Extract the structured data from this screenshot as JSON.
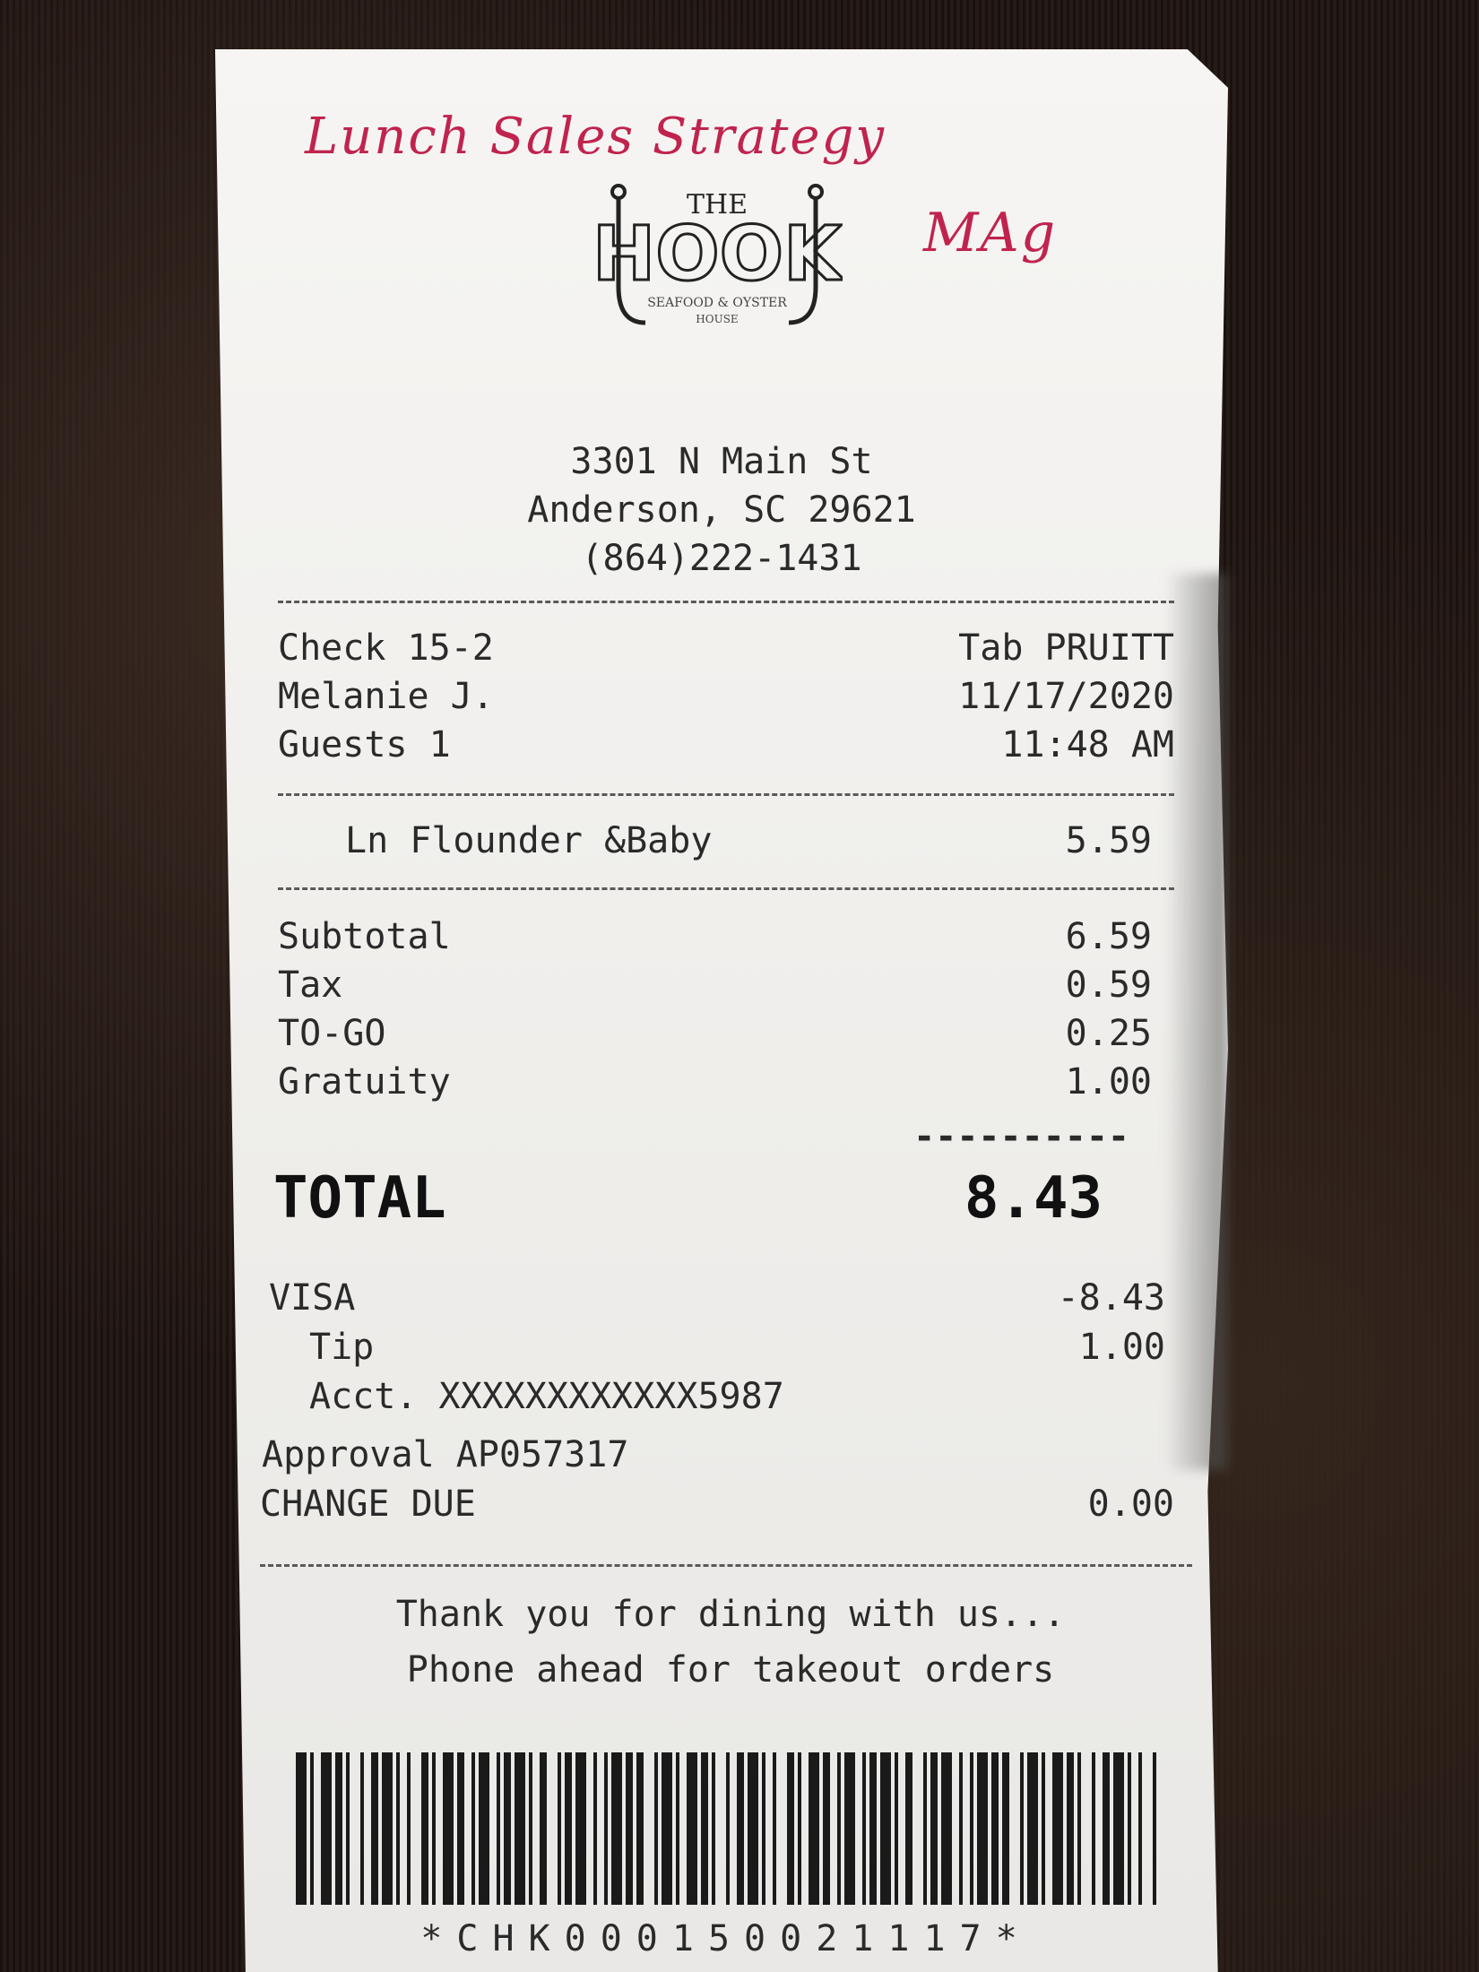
{
  "handwriting": {
    "line1": "Lunch Sales Strategy",
    "line2": "MAg"
  },
  "logo": {
    "top": "THE",
    "main": "HOOK",
    "sub1": "SEAFOOD & OYSTER",
    "sub2": "HOUSE"
  },
  "address": {
    "street": "3301 N Main St",
    "city": "Anderson, SC 29621",
    "phone": "(864)222-1431"
  },
  "check": {
    "number": "Check 15-2",
    "tab": "Tab PRUITT",
    "server": "Melanie J.",
    "date": "11/17/2020",
    "guests": "Guests 1",
    "time": "11:48 AM"
  },
  "items": [
    {
      "name": "Ln Flounder &Baby",
      "price": "5.59"
    }
  ],
  "totals": {
    "subtotal_label": "Subtotal",
    "subtotal": "6.59",
    "tax_label": "Tax",
    "tax": "0.59",
    "togo_label": "TO-GO",
    "togo": "0.25",
    "gratuity_label": "Gratuity",
    "gratuity": "1.00",
    "separator": "----------",
    "total_label": "TOTAL",
    "total": "8.43"
  },
  "payment": {
    "visa_label": "VISA",
    "visa": "-8.43",
    "tip_label": "Tip",
    "tip": "1.00",
    "acct": "Acct. XXXXXXXXXXXX5987",
    "approval": "Approval AP057317",
    "change_label": "CHANGE DUE",
    "change": "0.00"
  },
  "footer": {
    "line1": "Thank you for dining with us...",
    "line2": "Phone ahead for takeout orders"
  },
  "barcode": {
    "text": "*CHK000150021117*"
  }
}
